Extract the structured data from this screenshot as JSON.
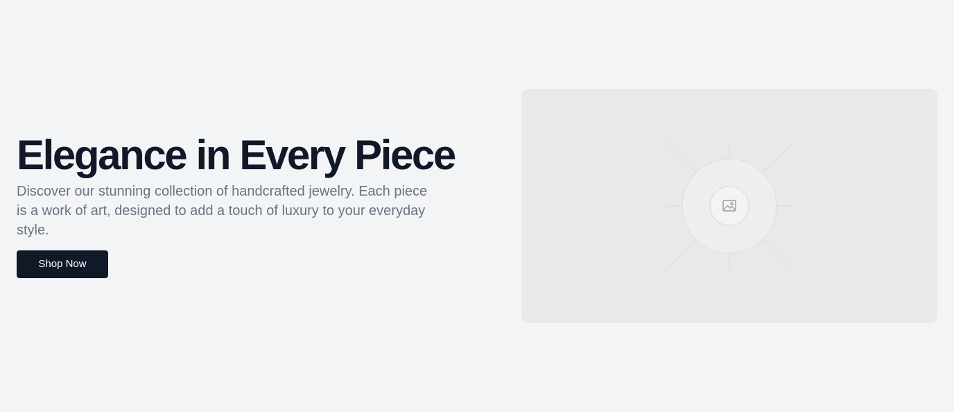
{
  "hero": {
    "title": "Elegance in Every Piece",
    "description": "Discover our stunning collection of handcrafted jewelry. Each piece is a work of art, designed to add a touch of luxury to your everyday style.",
    "cta_label": "Shop Now"
  },
  "image_placeholder": {
    "icon": "image-icon"
  },
  "colors": {
    "page_background": "#f3f4f6",
    "title": "#111827",
    "body_text": "#6b7280",
    "button_background": "#111827",
    "button_text": "#ffffff",
    "image_panel": "#e9e9ea"
  }
}
